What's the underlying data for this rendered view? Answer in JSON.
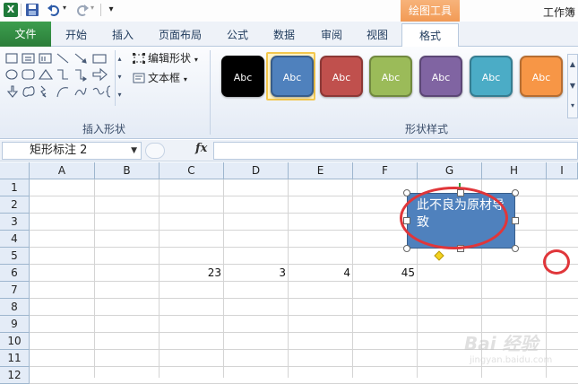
{
  "titlebar": {
    "contextual_tab_group": "绘图工具",
    "window_title": "工作簿",
    "qa_icons": [
      "excel-logo-icon",
      "save-icon",
      "undo-icon",
      "redo-icon",
      "customize-toolbar-icon"
    ]
  },
  "tabs": {
    "file": "文件",
    "items": [
      "开始",
      "插入",
      "页面布局",
      "公式",
      "数据",
      "审阅",
      "视图"
    ],
    "format": "格式"
  },
  "ribbon": {
    "insert_shapes_label": "插入形状",
    "shape_styles_label": "形状样式",
    "edit_shape": "编辑形状",
    "text_box": "文本框",
    "swatch_text": "Abc",
    "swatches": [
      {
        "color": "#000000",
        "border": "#000000"
      },
      {
        "color": "#4f81bd",
        "border": "#385d8a"
      },
      {
        "color": "#c0504d",
        "border": "#8c3836"
      },
      {
        "color": "#9bbb59",
        "border": "#71893f"
      },
      {
        "color": "#8064a2",
        "border": "#5c4776"
      },
      {
        "color": "#4bacc6",
        "border": "#357d91"
      },
      {
        "color": "#f79646",
        "border": "#b66d31"
      }
    ],
    "selected_swatch_index": 1
  },
  "formula_bar": {
    "name_box": "矩形标注 2",
    "fx": "fx",
    "formula": ""
  },
  "grid": {
    "columns": [
      "A",
      "B",
      "C",
      "D",
      "E",
      "F",
      "G",
      "H",
      "I"
    ],
    "rows": [
      "1",
      "2",
      "3",
      "4",
      "5",
      "6",
      "7",
      "8",
      "9",
      "10",
      "11",
      "12"
    ],
    "row6_values": {
      "C": "23",
      "D": "3",
      "E": "4",
      "F": "45"
    }
  },
  "callout": {
    "text": "此不良为原材导致",
    "fill": "#4f81bd"
  },
  "annotations": {
    "highlight_color": "#e0363a"
  },
  "watermark": {
    "brand": "Bai 经验",
    "site": "jingyan.baidu.com"
  }
}
